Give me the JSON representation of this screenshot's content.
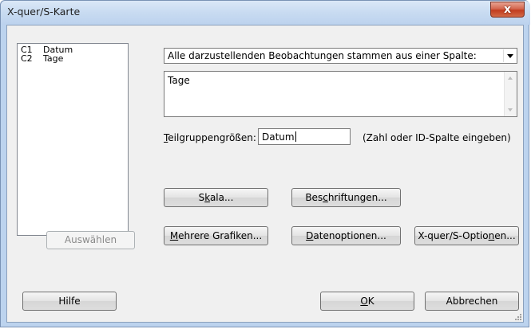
{
  "window": {
    "title": "X-quer/S-Karte",
    "close_label": "x"
  },
  "variables": [
    {
      "col": "C1",
      "name": "Datum"
    },
    {
      "col": "C2",
      "name": "Tage"
    }
  ],
  "buttons": {
    "select": "Auswählen",
    "help": "Hilfe",
    "ok": "OK",
    "cancel": "Abbrechen",
    "scale_prefix": "S",
    "scale_mnemonic": "k",
    "scale_suffix": "ala...",
    "labels_prefix": "Bes",
    "labels_mnemonic": "c",
    "labels_suffix": "hriftungen...",
    "multi_prefix": "",
    "multi_mnemonic": "M",
    "multi_suffix": "ehrere Grafiken...",
    "data_prefix": "",
    "data_mnemonic": "D",
    "data_suffix": "atenoptionen...",
    "xbar_prefix": "X-quer/S-Optio",
    "xbar_mnemonic": "n",
    "xbar_suffix": "en...",
    "ok_mnemonic": "O",
    "ok_suffix": "K"
  },
  "combo": {
    "selected": "Alle darzustellenden Beobachtungen stammen aus einer Spalte:"
  },
  "columns_box": {
    "value": "Tage"
  },
  "subgroup": {
    "label_mnemonic": "T",
    "label_rest": "eilgruppengrößen:",
    "value": "Datum",
    "hint": "(Zahl oder ID-Spalte eingeben)"
  },
  "icons": [
    "close-icon",
    "dropdown-arrow-icon",
    "scroll-up-icon",
    "scroll-down-icon",
    "resize-grip-icon"
  ]
}
